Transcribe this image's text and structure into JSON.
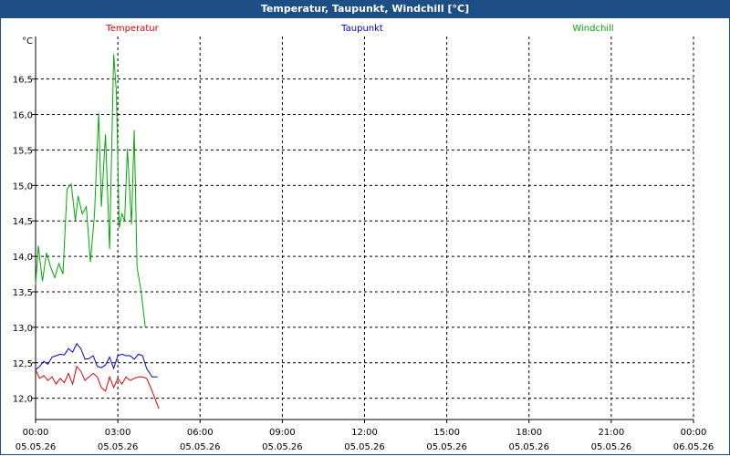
{
  "window": {
    "title": "Temperatur, Taupunkt, Windchill [°C]"
  },
  "chart_data": {
    "type": "line",
    "title": "Temperatur, Taupunkt, Windchill [°C]",
    "ylabel": "°C",
    "ylim": [
      11.7,
      17.1
    ],
    "xlim_hours": [
      0,
      24
    ],
    "grid": true,
    "legend_position": "top",
    "y_ticks": [
      {
        "v": 12.0,
        "label": "12,0"
      },
      {
        "v": 12.5,
        "label": "12,5"
      },
      {
        "v": 13.0,
        "label": "13,0"
      },
      {
        "v": 13.5,
        "label": "13,5"
      },
      {
        "v": 14.0,
        "label": "14,0"
      },
      {
        "v": 14.5,
        "label": "14,5"
      },
      {
        "v": 15.0,
        "label": "15,0"
      },
      {
        "v": 15.5,
        "label": "15,5"
      },
      {
        "v": 16.0,
        "label": "16,0"
      },
      {
        "v": 16.5,
        "label": "16,5"
      }
    ],
    "x_ticks": [
      {
        "h": 0,
        "time": "00:00",
        "date": "05.05.26"
      },
      {
        "h": 3,
        "time": "03:00",
        "date": "05.05.26"
      },
      {
        "h": 6,
        "time": "06:00",
        "date": "05.05.26"
      },
      {
        "h": 9,
        "time": "09:00",
        "date": "05.05.26"
      },
      {
        "h": 12,
        "time": "12:00",
        "date": "05.05.26"
      },
      {
        "h": 15,
        "time": "15:00",
        "date": "05.05.26"
      },
      {
        "h": 18,
        "time": "18:00",
        "date": "05.05.26"
      },
      {
        "h": 21,
        "time": "21:00",
        "date": "05.05.26"
      },
      {
        "h": 24,
        "time": "00:00",
        "date": "06.05.26"
      }
    ],
    "series": [
      {
        "name": "Windchill",
        "color": "#00aa00",
        "legend_pos": "right",
        "x": [
          0.0,
          0.1,
          0.25,
          0.4,
          0.55,
          0.7,
          0.85,
          1.0,
          1.15,
          1.3,
          1.45,
          1.55,
          1.7,
          1.85,
          2.0,
          2.15,
          2.3,
          2.4,
          2.55,
          2.7,
          2.85,
          2.95,
          3.05,
          3.15,
          3.25,
          3.35,
          3.5,
          3.6,
          3.7,
          3.85,
          4.0,
          4.1,
          4.2,
          4.3,
          4.45
        ],
        "y": [
          13.6,
          14.15,
          13.65,
          14.05,
          13.85,
          13.7,
          13.9,
          13.75,
          14.95,
          15.02,
          14.5,
          14.85,
          14.6,
          14.7,
          13.92,
          14.6,
          16.02,
          14.7,
          15.72,
          14.1,
          16.85,
          16.3,
          14.4,
          14.6,
          14.5,
          15.52,
          14.45,
          15.78,
          13.85,
          13.5,
          13.0,
          null,
          null,
          null,
          null
        ]
      },
      {
        "name": "Taupunkt",
        "color": "#0000cc",
        "legend_pos": "center",
        "x": [
          0.0,
          0.15,
          0.3,
          0.45,
          0.6,
          0.75,
          0.9,
          1.05,
          1.2,
          1.35,
          1.5,
          1.65,
          1.8,
          1.95,
          2.1,
          2.25,
          2.4,
          2.55,
          2.7,
          2.85,
          3.0,
          3.15,
          3.3,
          3.45,
          3.6,
          3.75,
          3.9,
          4.05,
          4.25,
          4.45
        ],
        "y": [
          12.4,
          12.45,
          12.52,
          12.48,
          12.58,
          12.6,
          12.62,
          12.61,
          12.7,
          12.65,
          12.77,
          12.7,
          12.55,
          12.56,
          12.6,
          12.45,
          12.43,
          12.47,
          12.58,
          12.42,
          12.6,
          12.62,
          12.6,
          12.6,
          12.55,
          12.62,
          12.6,
          12.42,
          12.3,
          12.3
        ]
      },
      {
        "name": "Temperatur",
        "color": "#dd0000",
        "legend_pos": "left",
        "x": [
          0.0,
          0.15,
          0.3,
          0.45,
          0.6,
          0.75,
          0.9,
          1.05,
          1.2,
          1.35,
          1.5,
          1.65,
          1.8,
          1.95,
          2.1,
          2.25,
          2.4,
          2.55,
          2.7,
          2.85,
          3.0,
          3.15,
          3.3,
          3.45,
          3.6,
          3.75,
          3.9,
          4.05,
          4.2,
          4.35,
          4.5
        ],
        "y": [
          12.4,
          12.28,
          12.32,
          12.25,
          12.3,
          12.2,
          12.28,
          12.22,
          12.35,
          12.2,
          12.45,
          12.38,
          12.25,
          12.3,
          12.35,
          12.3,
          12.15,
          12.1,
          12.3,
          12.15,
          12.28,
          12.2,
          12.3,
          12.25,
          12.28,
          12.3,
          12.3,
          12.28,
          12.15,
          12.0,
          11.85
        ]
      }
    ]
  }
}
